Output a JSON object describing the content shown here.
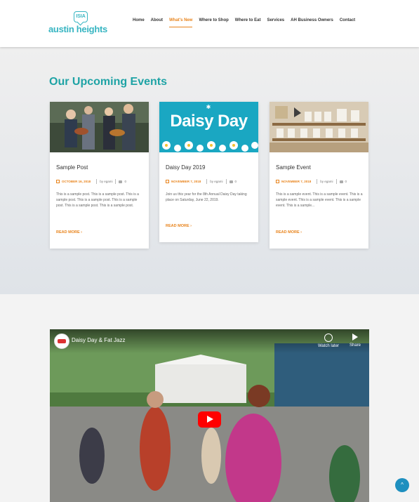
{
  "header": {
    "logo_bubble": "ISIA",
    "logo_text": "austin heights",
    "nav": [
      {
        "label": "Home",
        "active": false
      },
      {
        "label": "About",
        "active": false
      },
      {
        "label": "What's New",
        "active": true
      },
      {
        "label": "Where to Shop",
        "active": false
      },
      {
        "label": "Where to Eat",
        "active": false
      },
      {
        "label": "Services",
        "active": false
      },
      {
        "label": "AH Business Owners",
        "active": false
      },
      {
        "label": "Contact",
        "active": false
      }
    ]
  },
  "events": {
    "title": "Our Upcoming Events",
    "cards": [
      {
        "title": "Sample Post",
        "date": "OCTOBER 16, 2018",
        "author": "by egami",
        "comments": "0",
        "excerpt": "This is a sample post. This is a sample post. This is a sample post. This is a sample post. This is a sample post. This is a sample post. This is a sample post.",
        "read_more": "READ MORE ›"
      },
      {
        "title": "Daisy Day 2019",
        "image_text": "Daisy Day",
        "date": "NOVEMBER 7, 2018",
        "author": "by egami",
        "comments": "0",
        "excerpt": "Join us this year for the 8th Annual Daisy Day taking place on Saturday, June 22, 2019.",
        "read_more": "READ MORE ›"
      },
      {
        "title": "Sample Event",
        "date": "NOVEMBER 7, 2018",
        "author": "by egami",
        "comments": "0",
        "excerpt": "This is a sample event. This is a sample event. This is a sample event. This is a sample event. This is a sample event. This is a sample...",
        "read_more": "READ MORE ›"
      }
    ]
  },
  "video": {
    "title": "Daisy Day & Fat Jazz",
    "watch_later": "Watch later",
    "share": "Share"
  },
  "scroll_top": "^",
  "colors": {
    "accent_teal": "#1ea3a5",
    "accent_orange": "#e8831b",
    "youtube_red": "#ff0000",
    "scroll_btn": "#1e8fbf"
  }
}
